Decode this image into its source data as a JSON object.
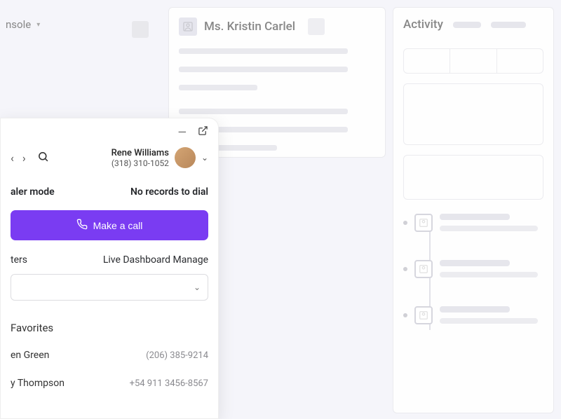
{
  "background": {
    "left_nav_label": "nsole",
    "contact_card": {
      "name": "Ms. Kristin Carlel"
    },
    "activity_panel": {
      "title": "Activity"
    }
  },
  "dialer": {
    "user": {
      "name": "Rene Williams",
      "phone": "(318) 310-1052"
    },
    "mode_label": "aler mode",
    "status_text": "No records to dial",
    "call_button_label": "Make a call",
    "links": {
      "left": "ters",
      "right": "Live Dashboard Manage"
    },
    "favorites_heading": "Favorites",
    "favorites": [
      {
        "name": "en Green",
        "phone": "(206) 385-9214"
      },
      {
        "name": "y Thompson",
        "phone": "+54 911 3456-8567"
      }
    ]
  }
}
